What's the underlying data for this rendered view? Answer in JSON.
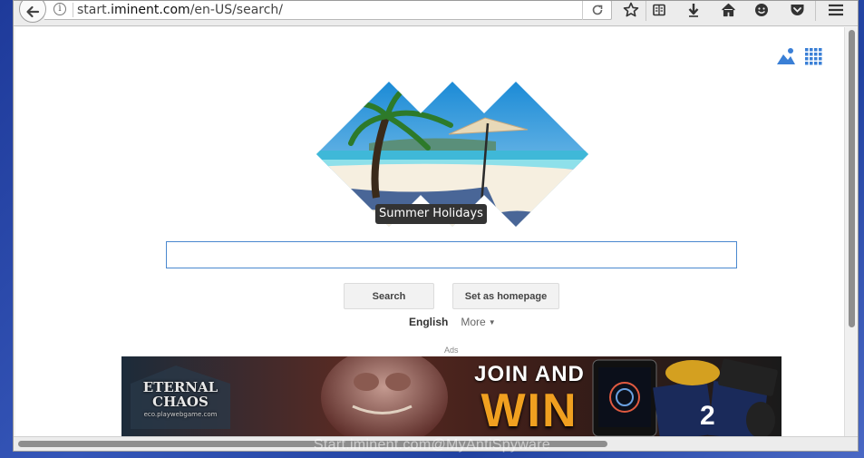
{
  "browser": {
    "url_prefix": "start.",
    "url_domain": "iminent.com",
    "url_path": "/en-US/search/",
    "info_glyph": "i",
    "toolbar_icons": [
      "star-icon",
      "reading-list-icon",
      "download-icon",
      "home-icon",
      "smiley-icon",
      "pocket-icon",
      "menu-icon"
    ]
  },
  "page": {
    "hero_caption": "Summer Holidays",
    "search_value": "",
    "search_button": "Search",
    "homepage_button": "Set as homepage",
    "language": "English",
    "more_label": "More",
    "more_caret": "▼",
    "ads_label": "Ads"
  },
  "ad_banner": {
    "game_title_1": "ETERNAL",
    "game_title_2": "CHAOS",
    "game_url": "eco.playwebgame.com",
    "join_text": "JOIN AND",
    "win_text": "WIN",
    "gift_card_digit": "2"
  },
  "watermark": "Start.iminent.com@MyAntiSpyware",
  "colors": {
    "accent_blue": "#4a88cf",
    "win_orange": "#f0a020"
  }
}
